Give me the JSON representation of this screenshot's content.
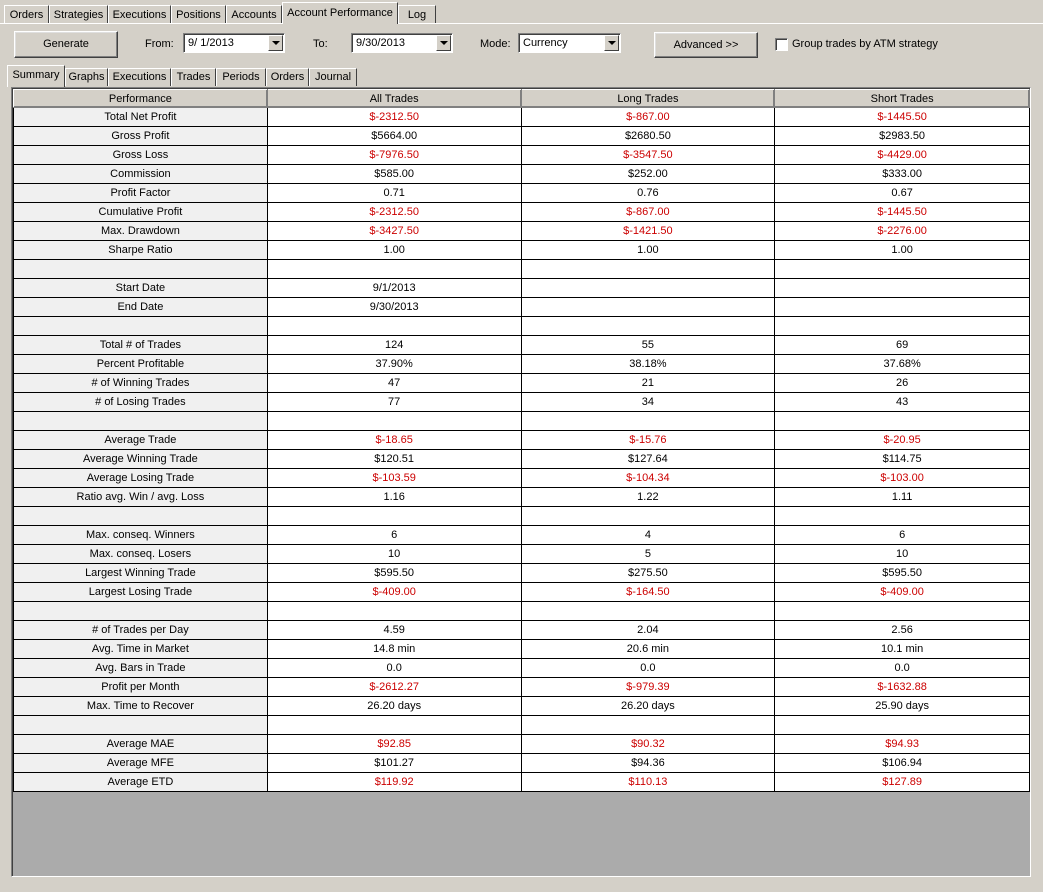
{
  "top_tabs": [
    "Orders",
    "Strategies",
    "Executions",
    "Positions",
    "Accounts",
    "Account Performance",
    "Log"
  ],
  "active_top_tab": "Account Performance",
  "toolbar": {
    "generate_label": "Generate",
    "from_label": "From:",
    "from_value": "9/  1/2013",
    "to_label": "To:",
    "to_value": "9/30/2013",
    "mode_label": "Mode:",
    "mode_value": "Currency",
    "advanced_label": "Advanced >>",
    "group_label": "Group trades by ATM strategy",
    "group_checked": false
  },
  "sub_tabs": [
    "Summary",
    "Graphs",
    "Executions",
    "Trades",
    "Periods",
    "Orders",
    "Journal"
  ],
  "active_sub_tab": "Summary",
  "colors": {
    "negative": "#cc0000",
    "grid_background": "#ababab",
    "label_cell": "#f0f0f0"
  },
  "table": {
    "columns": [
      "Performance",
      "All Trades",
      "Long Trades",
      "Short Trades"
    ],
    "rows": [
      {
        "label": "Total Net Profit",
        "all": "$-2312.50",
        "long": "$-867.00",
        "short": "$-1445.50",
        "neg": true
      },
      {
        "label": "Gross Profit",
        "all": "$5664.00",
        "long": "$2680.50",
        "short": "$2983.50",
        "neg": false
      },
      {
        "label": "Gross Loss",
        "all": "$-7976.50",
        "long": "$-3547.50",
        "short": "$-4429.00",
        "neg": true
      },
      {
        "label": "Commission",
        "all": "$585.00",
        "long": "$252.00",
        "short": "$333.00",
        "neg": false
      },
      {
        "label": "Profit Factor",
        "all": "0.71",
        "long": "0.76",
        "short": "0.67",
        "neg": false
      },
      {
        "label": "Cumulative Profit",
        "all": "$-2312.50",
        "long": "$-867.00",
        "short": "$-1445.50",
        "neg": true
      },
      {
        "label": "Max. Drawdown",
        "all": "$-3427.50",
        "long": "$-1421.50",
        "short": "$-2276.00",
        "neg": true
      },
      {
        "label": "Sharpe Ratio",
        "all": "1.00",
        "long": "1.00",
        "short": "1.00",
        "neg": false
      },
      {
        "label": "",
        "all": "",
        "long": "",
        "short": "",
        "neg": false
      },
      {
        "label": "Start Date",
        "all": "9/1/2013",
        "long": "",
        "short": "",
        "neg": false
      },
      {
        "label": "End Date",
        "all": "9/30/2013",
        "long": "",
        "short": "",
        "neg": false
      },
      {
        "label": "",
        "all": "",
        "long": "",
        "short": "",
        "neg": false
      },
      {
        "label": "Total # of Trades",
        "all": "124",
        "long": "55",
        "short": "69",
        "neg": false
      },
      {
        "label": "Percent Profitable",
        "all": "37.90%",
        "long": "38.18%",
        "short": "37.68%",
        "neg": false
      },
      {
        "label": "# of Winning Trades",
        "all": "47",
        "long": "21",
        "short": "26",
        "neg": false
      },
      {
        "label": "# of Losing Trades",
        "all": "77",
        "long": "34",
        "short": "43",
        "neg": false
      },
      {
        "label": "",
        "all": "",
        "long": "",
        "short": "",
        "neg": false
      },
      {
        "label": "Average Trade",
        "all": "$-18.65",
        "long": "$-15.76",
        "short": "$-20.95",
        "neg": true
      },
      {
        "label": "Average Winning Trade",
        "all": "$120.51",
        "long": "$127.64",
        "short": "$114.75",
        "neg": false
      },
      {
        "label": "Average Losing Trade",
        "all": "$-103.59",
        "long": "$-104.34",
        "short": "$-103.00",
        "neg": true
      },
      {
        "label": "Ratio avg. Win / avg. Loss",
        "all": "1.16",
        "long": "1.22",
        "short": "1.11",
        "neg": false
      },
      {
        "label": "",
        "all": "",
        "long": "",
        "short": "",
        "neg": false
      },
      {
        "label": "Max. conseq. Winners",
        "all": "6",
        "long": "4",
        "short": "6",
        "neg": false
      },
      {
        "label": "Max. conseq. Losers",
        "all": "10",
        "long": "5",
        "short": "10",
        "neg": false
      },
      {
        "label": "Largest Winning Trade",
        "all": "$595.50",
        "long": "$275.50",
        "short": "$595.50",
        "neg": false
      },
      {
        "label": "Largest Losing Trade",
        "all": "$-409.00",
        "long": "$-164.50",
        "short": "$-409.00",
        "neg": true
      },
      {
        "label": "",
        "all": "",
        "long": "",
        "short": "",
        "neg": false
      },
      {
        "label": "# of Trades per Day",
        "all": "4.59",
        "long": "2.04",
        "short": "2.56",
        "neg": false
      },
      {
        "label": "Avg. Time in Market",
        "all": "14.8 min",
        "long": "20.6 min",
        "short": "10.1 min",
        "neg": false
      },
      {
        "label": "Avg. Bars in Trade",
        "all": "0.0",
        "long": "0.0",
        "short": "0.0",
        "neg": false
      },
      {
        "label": "Profit per Month",
        "all": "$-2612.27",
        "long": "$-979.39",
        "short": "$-1632.88",
        "neg": true
      },
      {
        "label": "Max. Time to Recover",
        "all": "26.20 days",
        "long": "26.20 days",
        "short": "25.90 days",
        "neg": false
      },
      {
        "label": "",
        "all": "",
        "long": "",
        "short": "",
        "neg": false
      },
      {
        "label": "Average MAE",
        "all": "$92.85",
        "long": "$90.32",
        "short": "$94.93",
        "neg": true
      },
      {
        "label": "Average MFE",
        "all": "$101.27",
        "long": "$94.36",
        "short": "$106.94",
        "neg": false
      },
      {
        "label": "Average ETD",
        "all": "$119.92",
        "long": "$110.13",
        "short": "$127.89",
        "neg": true
      }
    ]
  }
}
